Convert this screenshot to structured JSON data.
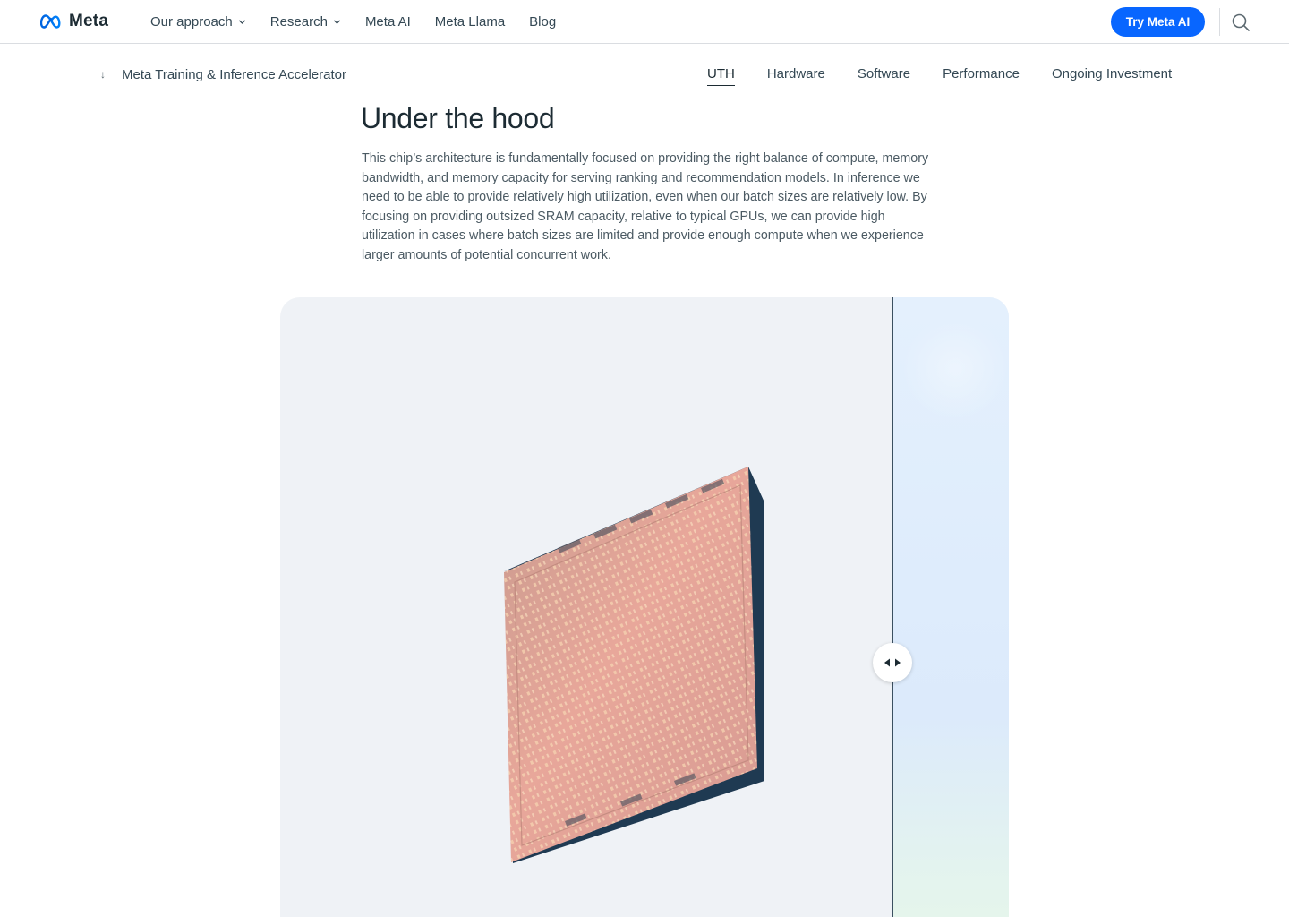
{
  "topnav": {
    "logo_text": "Meta",
    "items": [
      {
        "label": "Our approach",
        "has_dropdown": true
      },
      {
        "label": "Research",
        "has_dropdown": true
      },
      {
        "label": "Meta AI",
        "has_dropdown": false
      },
      {
        "label": "Meta Llama",
        "has_dropdown": false
      },
      {
        "label": "Blog",
        "has_dropdown": false
      }
    ],
    "cta_label": "Try Meta AI",
    "search_icon": "search-icon"
  },
  "subnav": {
    "arrow": "↓",
    "title": "Meta Training & Inference Accelerator",
    "tabs": [
      "UTH",
      "Hardware",
      "Software",
      "Performance",
      "Ongoing Investment"
    ],
    "active_tab": "UTH"
  },
  "main": {
    "heading": "Under the hood",
    "body": "This chip’s architecture is fundamentally focused on providing the right balance of compute, memory bandwidth, and memory capacity for serving ranking and recommendation models. In inference we need to be able to provide relatively high utilization, even when our batch sizes are relatively low. By focusing on providing outsized SRAM capacity, relative to typical GPUs, we can provide high utilization in cases where batch sizes are limited and provide enough compute when we experience larger amounts of potential concurrent work."
  },
  "comparison": {
    "handle_icon": "left-right-arrows-icon",
    "colors": {
      "accent": "#0866ff",
      "card_bg": "#eff2f6"
    }
  }
}
